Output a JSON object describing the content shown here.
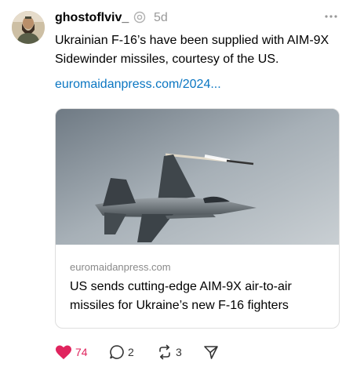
{
  "post": {
    "author": {
      "username": "ghostoflviv_",
      "avatar_icon": "avatar-icon",
      "badge_icon": "threads-badge-icon"
    },
    "time": "5d",
    "more_icon": "more-icon",
    "text": "Ukrainian F-16’s have been supplied with AIM-9X Sidewinder missiles, courtesy of the US.",
    "link_text": "euromaidanpress.com/2024..."
  },
  "card": {
    "image_icon": "f16-jet-image",
    "domain": "euromaidanpress.com",
    "title": "US sends cutting-edge AIM-9X air-to-air missiles for Ukraine’s new F-16 fighters"
  },
  "actions": {
    "like": {
      "count": "74",
      "icon": "heart-icon",
      "color": "#e0245e"
    },
    "reply": {
      "count": "2",
      "icon": "comment-icon"
    },
    "repost": {
      "count": "3",
      "icon": "repost-icon"
    },
    "share": {
      "icon": "share-icon"
    }
  },
  "colors": {
    "link": "#0a76c2",
    "muted": "#999999",
    "like": "#e0245e"
  }
}
